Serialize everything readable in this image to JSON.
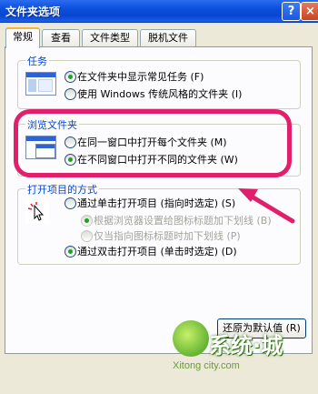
{
  "window": {
    "title": "文件夹选项",
    "help_icon": "?",
    "close_icon": "×"
  },
  "tabs": [
    {
      "label": "常规"
    },
    {
      "label": "查看"
    },
    {
      "label": "文件类型"
    },
    {
      "label": "脱机文件"
    }
  ],
  "tasks": {
    "title": "任务",
    "options": [
      {
        "label": "在文件夹中显示常见任务 (F)"
      },
      {
        "label": "使用 Windows 传统风格的文件夹 (I)"
      }
    ]
  },
  "browse": {
    "title": "浏览文件夹",
    "options": [
      {
        "label": "在同一窗口中打开每个文件夹 (M)"
      },
      {
        "label": "在不同窗口中打开不同的文件夹 (W)"
      }
    ]
  },
  "click": {
    "title": "打开项目的方式",
    "options": [
      {
        "label": "通过单击打开项目 (指向时选定) (S)"
      },
      {
        "label": "根据浏览器设置给图标标题加下划线 (B)"
      },
      {
        "label": "仅当指向图标标题时加下划线 (P)"
      },
      {
        "label": "通过双击打开项目 (单击时选定) (D)"
      }
    ]
  },
  "buttons": {
    "restore": "还原为默认值 (R)"
  },
  "watermark": {
    "text": "系统·城",
    "url": "Xitong city.com"
  },
  "colors": {
    "highlight": "#e0206a",
    "group_title": "#0046d5"
  }
}
